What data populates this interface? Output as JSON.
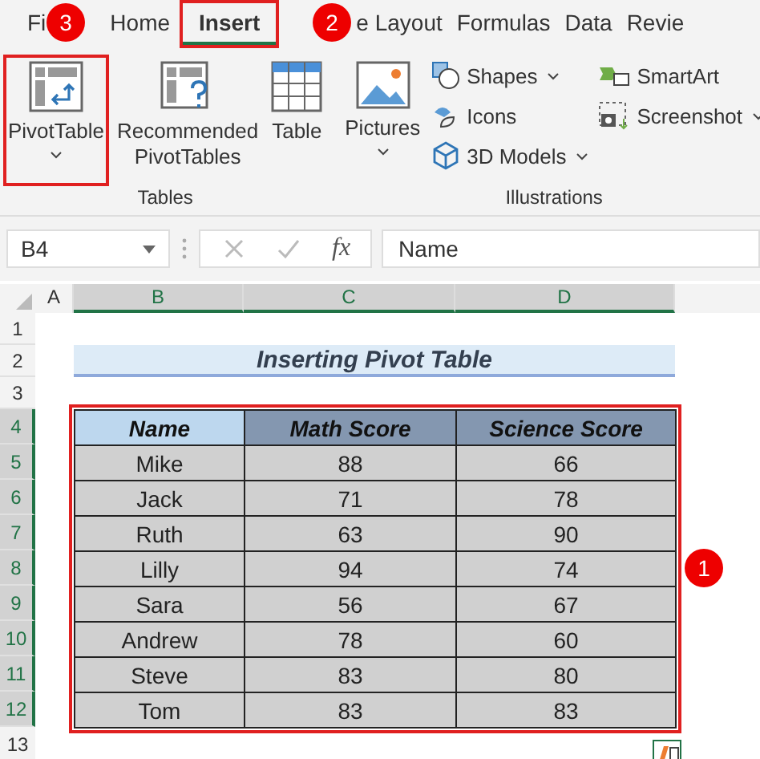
{
  "tabs": [
    {
      "label": "Fi",
      "selected": false,
      "highlighted": false
    },
    {
      "label": "Home",
      "selected": false,
      "highlighted": false
    },
    {
      "label": "Insert",
      "selected": true,
      "highlighted": true
    },
    {
      "label": "e Layout",
      "selected": false,
      "highlighted": false
    },
    {
      "label": "Formulas",
      "selected": false,
      "highlighted": false
    },
    {
      "label": "Data",
      "selected": false,
      "highlighted": false
    },
    {
      "label": "Revie",
      "selected": false,
      "highlighted": false
    }
  ],
  "callouts": [
    "3",
    "2",
    "1"
  ],
  "ribbon": {
    "groups": [
      {
        "title": "Tables",
        "items": [
          {
            "kind": "large",
            "label": "PivotTable",
            "dropdown": true,
            "highlighted": true
          },
          {
            "kind": "large",
            "label": "Recommended PivotTables",
            "dropdown": false,
            "highlighted": false
          },
          {
            "kind": "large",
            "label": "Table",
            "dropdown": false,
            "highlighted": false
          }
        ]
      },
      {
        "title": "Illustrations",
        "items": [
          {
            "kind": "large",
            "label": "Pictures",
            "dropdown": true,
            "highlighted": false
          },
          {
            "kind": "stack",
            "items": [
              {
                "label": "Shapes",
                "dropdown": true
              },
              {
                "label": "Icons",
                "dropdown": false
              },
              {
                "label": "3D Models",
                "dropdown": true
              }
            ]
          },
          {
            "kind": "stack",
            "items": [
              {
                "label": "SmartArt",
                "dropdown": false
              },
              {
                "label": "Screenshot",
                "dropdown": true
              }
            ]
          }
        ]
      }
    ]
  },
  "formula_bar": {
    "name_box": "B4",
    "function_label": "fx",
    "value": "Name"
  },
  "sheet": {
    "columns": [
      {
        "label": "A",
        "selected": false
      },
      {
        "label": "B",
        "selected": true
      },
      {
        "label": "C",
        "selected": true
      },
      {
        "label": "D",
        "selected": true
      }
    ],
    "row_numbers": [
      {
        "label": "1",
        "selected": false
      },
      {
        "label": "2",
        "selected": false
      },
      {
        "label": "3",
        "selected": false
      },
      {
        "label": "4",
        "selected": true
      },
      {
        "label": "5",
        "selected": true
      },
      {
        "label": "6",
        "selected": true
      },
      {
        "label": "7",
        "selected": true
      },
      {
        "label": "8",
        "selected": true
      },
      {
        "label": "9",
        "selected": true
      },
      {
        "label": "10",
        "selected": true
      },
      {
        "label": "11",
        "selected": true
      },
      {
        "label": "12",
        "selected": true
      },
      {
        "label": "13",
        "selected": false
      }
    ],
    "title": "Inserting Pivot Table",
    "table": {
      "highlighted": true,
      "header": [
        {
          "text": "Name",
          "selected": true
        },
        {
          "text": "Math Score",
          "selected": false
        },
        {
          "text": "Science Score",
          "selected": false
        }
      ],
      "rows": [
        [
          "Mike",
          "88",
          "66"
        ],
        [
          "Jack",
          "71",
          "78"
        ],
        [
          "Ruth",
          "63",
          "90"
        ],
        [
          "Lilly",
          "94",
          "74"
        ],
        [
          "Sara",
          "56",
          "67"
        ],
        [
          "Andrew",
          "78",
          "60"
        ],
        [
          "Steve",
          "83",
          "80"
        ],
        [
          "Tom",
          "83",
          "83"
        ]
      ]
    }
  }
}
